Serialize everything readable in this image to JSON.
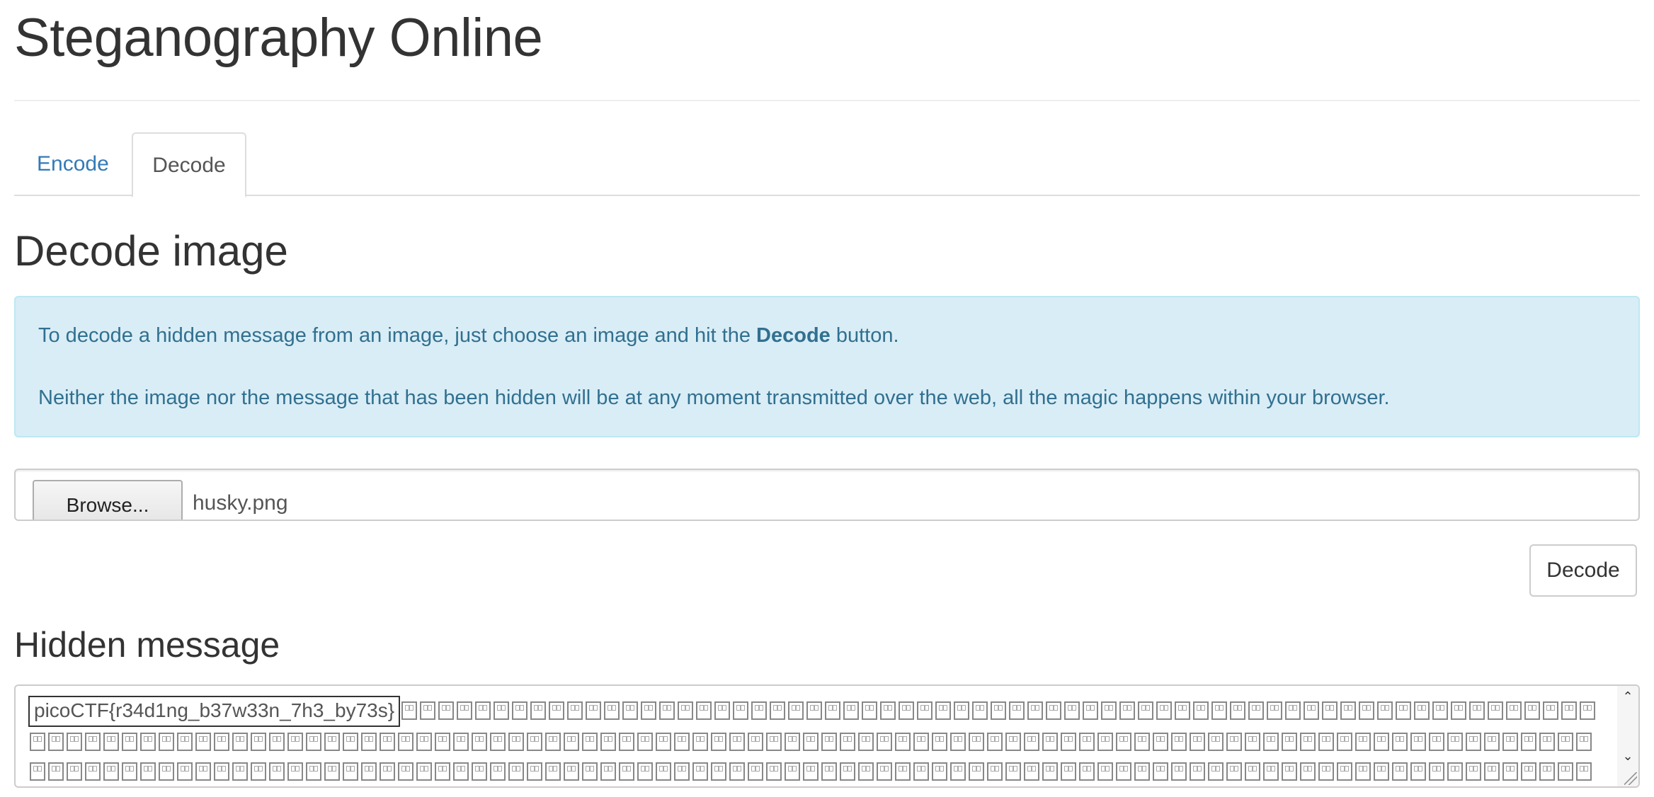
{
  "header": {
    "title": "Steganography Online"
  },
  "tabs": [
    {
      "label": "Encode",
      "active": false
    },
    {
      "label": "Decode",
      "active": true
    }
  ],
  "decode": {
    "heading": "Decode image",
    "info": {
      "line1_prefix": "To decode a hidden message from an image, just choose an image and hit the ",
      "line1_bold": "Decode",
      "line1_suffix": " button.",
      "line2": "Neither the image nor the message that has been hidden will be at any moment transmitted over the web, all the magic happens within your browser."
    },
    "file_input": {
      "button_label": "Browse...",
      "file_name": "husky.png"
    },
    "decode_button_label": "Decode"
  },
  "hidden_message": {
    "heading": "Hidden message",
    "flag_text": "picoCTF{r34d1ng_b37w33n_7h3_by73s}",
    "trailing_glyph": "unprintable-character-box"
  },
  "colors": {
    "link": "#337ab7",
    "info_background": "#d9edf7",
    "info_border": "#bce8f1",
    "info_text": "#31708f"
  }
}
